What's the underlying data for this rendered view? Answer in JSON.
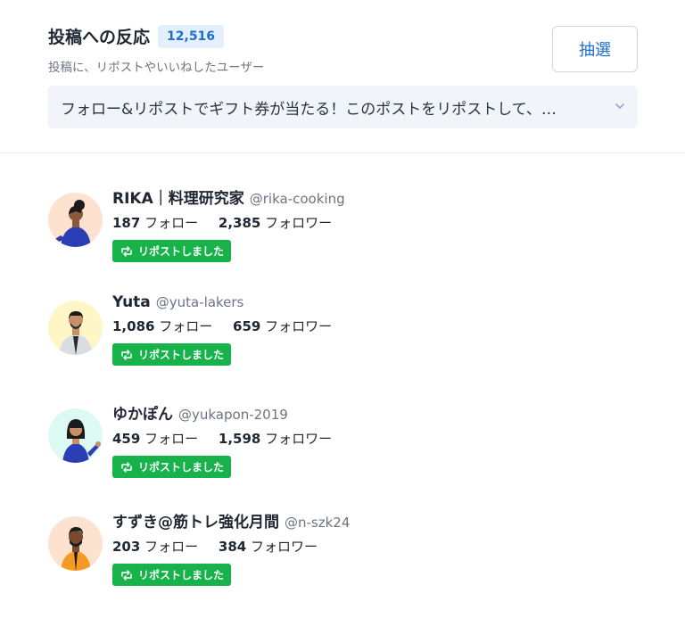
{
  "header": {
    "title": "投稿への反応",
    "count": "12,516",
    "subtitle": "投稿に、リポストやいいねしたユーザー",
    "draw_button_label": "抽選"
  },
  "post_select": {
    "selected": "フォロー&リポストでギフト券が当たる！このポストをリポストして、…"
  },
  "users": [
    {
      "name": "RIKA｜料理研究家",
      "handle": "@rika-cooking",
      "following": "187",
      "following_label": "フォロー",
      "followers": "2,385",
      "followers_label": "フォロワー",
      "badge": "リポストしました"
    },
    {
      "name": "Yuta",
      "handle": "@yuta-lakers",
      "following": "1,086",
      "following_label": "フォロー",
      "followers": "659",
      "followers_label": "フォロワー",
      "badge": "リポストしました"
    },
    {
      "name": "ゆかぽん",
      "handle": "@yukapon-2019",
      "following": "459",
      "following_label": "フォロー",
      "followers": "1,598",
      "followers_label": "フォロワー",
      "badge": "リポストしました"
    },
    {
      "name": "すずき@筋トレ強化月間",
      "handle": "@n-szk24",
      "following": "203",
      "following_label": "フォロー",
      "followers": "384",
      "followers_label": "フォロワー",
      "badge": "リポストしました"
    }
  ],
  "colors": {
    "accent": "#1d6fce",
    "badge_bg": "#e3f0fc",
    "repost_green": "#17b24a",
    "select_bg": "#f1f4f8"
  },
  "icons": [
    "chevron-down-icon",
    "repost-icon",
    "avatar"
  ]
}
